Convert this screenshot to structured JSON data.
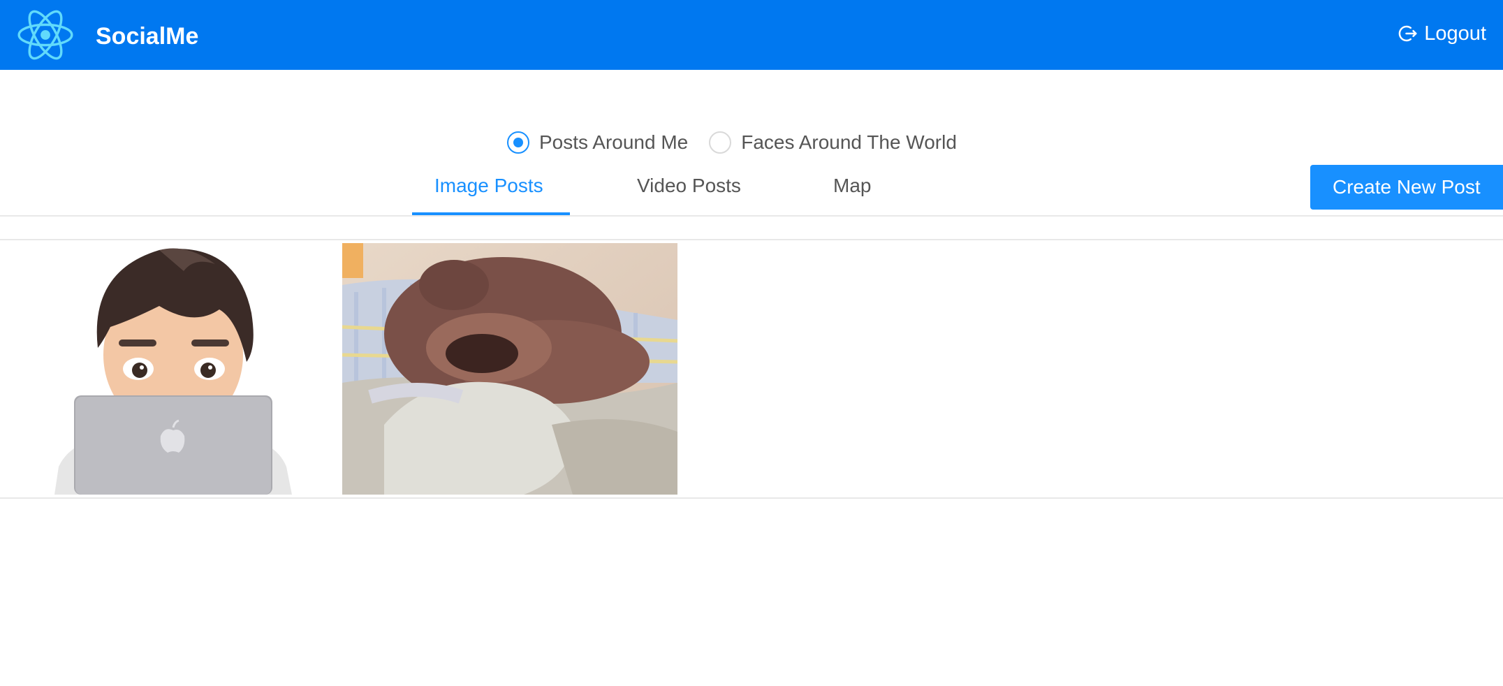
{
  "header": {
    "app_title": "SocialMe",
    "logo_icon": "react-atom-icon",
    "logout_label": "Logout",
    "logout_icon": "logout-icon",
    "background_color": "#0078f0"
  },
  "filter": {
    "options": [
      {
        "label": "Posts Around Me",
        "selected": true
      },
      {
        "label": "Faces Around The World",
        "selected": false
      }
    ]
  },
  "tabs": {
    "items": [
      {
        "label": "Image Posts",
        "active": true
      },
      {
        "label": "Video Posts",
        "active": false
      },
      {
        "label": "Map",
        "active": false
      }
    ],
    "accent_color": "#1890ff"
  },
  "actions": {
    "create_post_label": "Create New Post"
  },
  "gallery": {
    "images": [
      {
        "subject": "memoji-avatar-with-laptop"
      },
      {
        "subject": "teddy-bear-on-bed"
      }
    ]
  }
}
